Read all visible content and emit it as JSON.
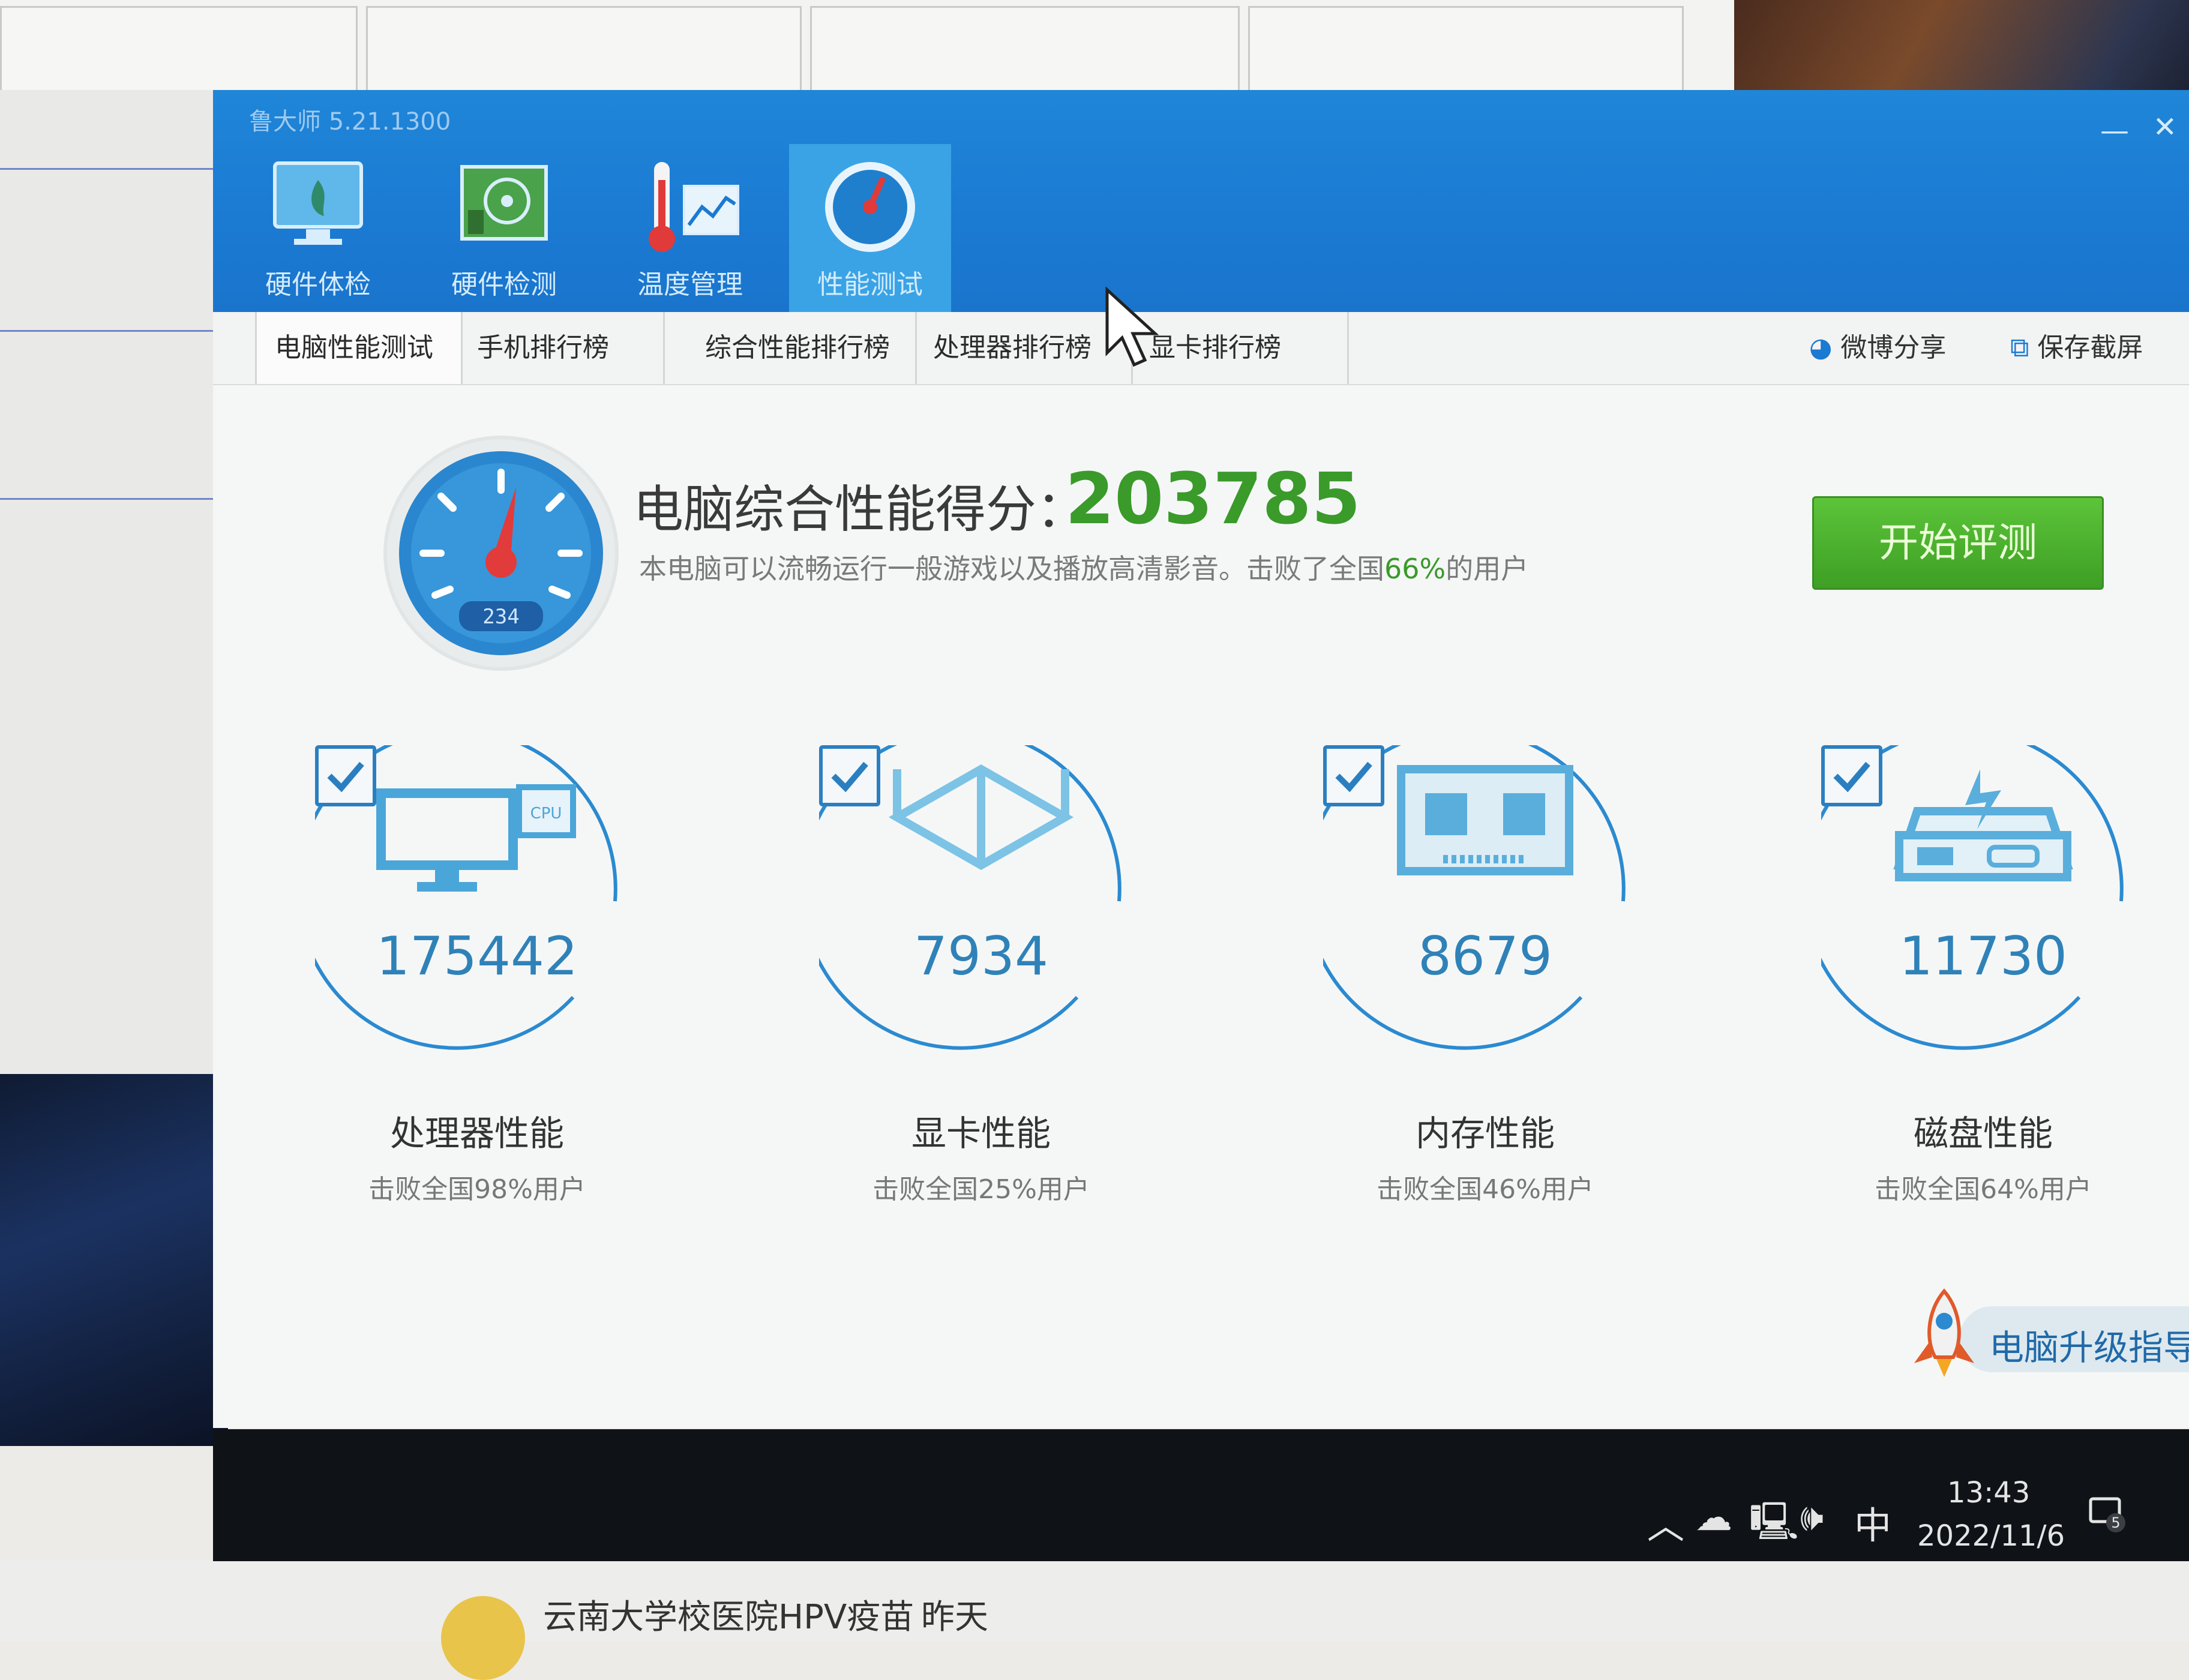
{
  "window": {
    "app_title": "鲁大师 5.21.1300",
    "minimize_glyph": "—",
    "close_glyph": "✕"
  },
  "nav_tabs": [
    {
      "label": "硬件体检",
      "icon": "monitor-icon"
    },
    {
      "label": "硬件检测",
      "icon": "motherboard-icon"
    },
    {
      "label": "温度管理",
      "icon": "thermometer-icon"
    },
    {
      "label": "性能测试",
      "icon": "speedometer-icon",
      "active": true
    }
  ],
  "sub_tabs": [
    {
      "label": "电脑性能测试",
      "active": true
    },
    {
      "label": "手机排行榜"
    },
    {
      "label": "综合性能排行榜"
    },
    {
      "label": "处理器排行榜"
    },
    {
      "label": "显卡排行榜"
    }
  ],
  "actions": {
    "weibo_share": "微博分享",
    "save_screenshot": "保存截屏"
  },
  "score": {
    "label": "电脑综合性能得分：",
    "value": "203785",
    "desc_prefix": "本电脑可以流畅运行一般游戏以及播放高清影音。击败了全国",
    "desc_pct": "66%",
    "desc_suffix": "的用户",
    "gauge_reading": "234"
  },
  "start_button": "开始评测",
  "metrics": [
    {
      "value": "175442",
      "name": "处理器性能",
      "sub": "击败全国98%用户",
      "icon": "cpu-monitor-icon"
    },
    {
      "value": "7934",
      "name": "显卡性能",
      "sub": "击败全国25%用户",
      "icon": "cube-icon"
    },
    {
      "value": "8679",
      "name": "内存性能",
      "sub": "击败全国46%用户",
      "icon": "memory-chip-icon"
    },
    {
      "value": "11730",
      "name": "磁盘性能",
      "sub": "击败全国64%用户",
      "icon": "disk-drive-icon"
    }
  ],
  "upgrade_guide": "电脑升级指导",
  "taskbar": {
    "ime": "中",
    "time": "13:43",
    "date": "2022/11/6",
    "notification_count": "5"
  },
  "background": {
    "notification_title": "云南大学校医院HPV疫苗",
    "notification_time": "昨天"
  },
  "colors": {
    "title_blue": "#1b7ad2",
    "score_green": "#3a9a2a",
    "ring_blue": "#2b8ad0",
    "button_green": "#4db22e"
  }
}
